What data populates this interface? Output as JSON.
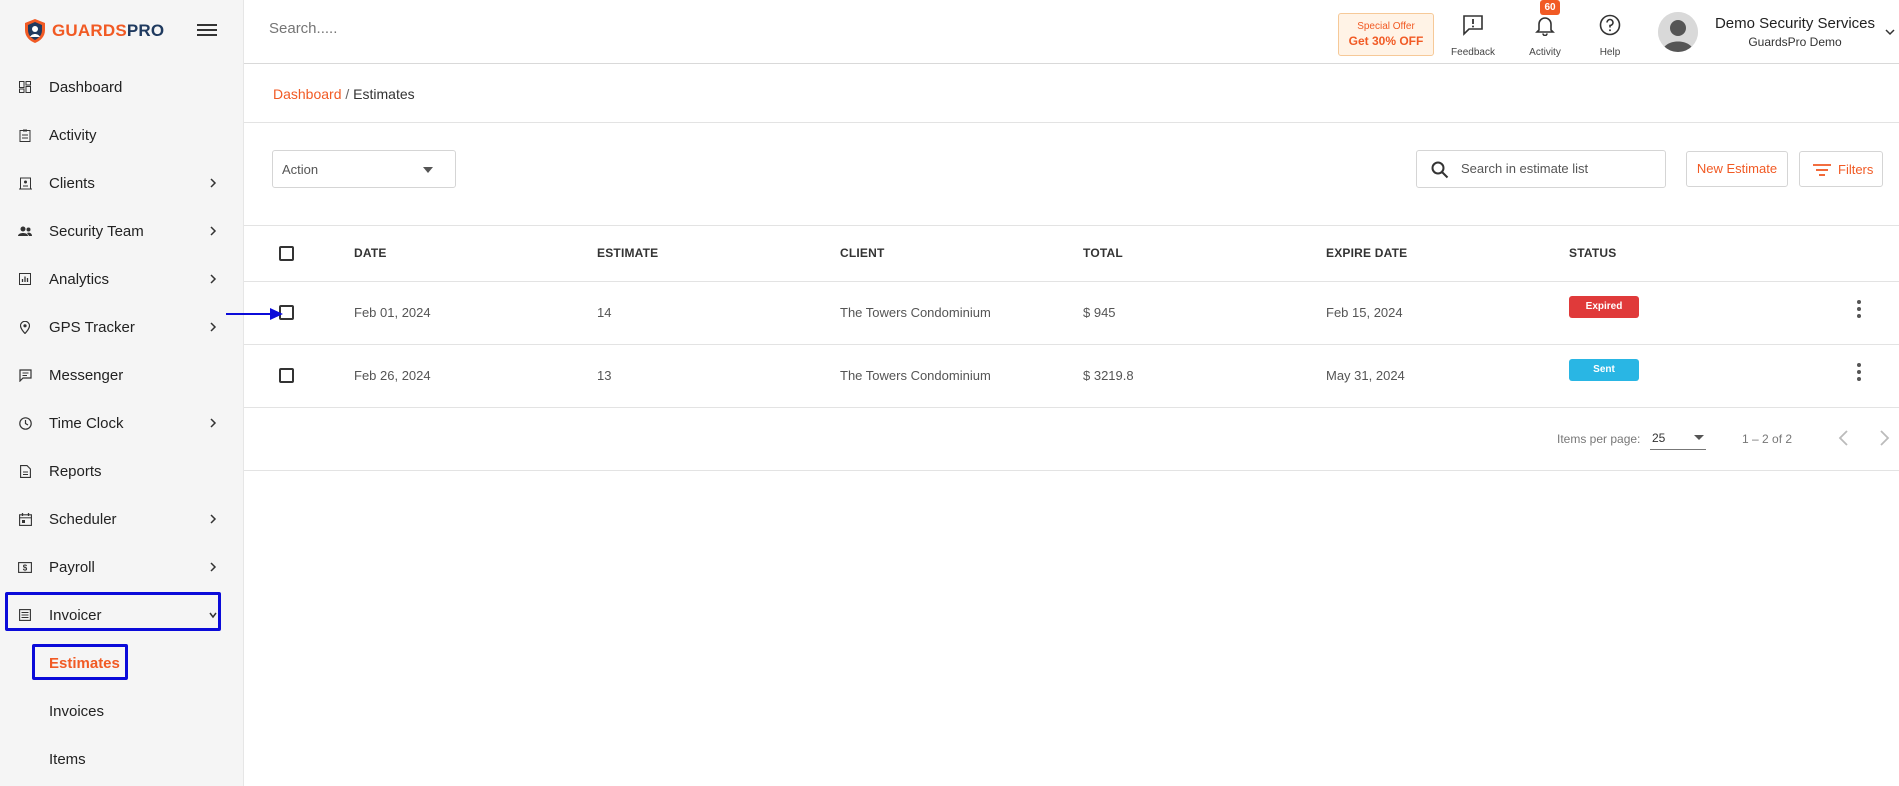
{
  "brand": {
    "part1": "GUARDS",
    "part2": "PRO"
  },
  "colors": {
    "accent": "#f15a24",
    "expired": "#e03a3a",
    "sent": "#29b6e4",
    "highlight": "#0b0bd9"
  },
  "sidebar": {
    "items": [
      {
        "label": "Dashboard",
        "icon": "dashboard-icon",
        "chevron": false
      },
      {
        "label": "Activity",
        "icon": "clipboard-icon",
        "chevron": false
      },
      {
        "label": "Clients",
        "icon": "building-icon",
        "chevron": true
      },
      {
        "label": "Security Team",
        "icon": "team-icon",
        "chevron": true
      },
      {
        "label": "Analytics",
        "icon": "chart-icon",
        "chevron": true
      },
      {
        "label": "GPS Tracker",
        "icon": "location-pin-icon",
        "chevron": true
      },
      {
        "label": "Messenger",
        "icon": "message-icon",
        "chevron": false
      },
      {
        "label": "Time Clock",
        "icon": "clock-icon",
        "chevron": true
      },
      {
        "label": "Reports",
        "icon": "report-icon",
        "chevron": false
      },
      {
        "label": "Scheduler",
        "icon": "calendar-icon",
        "chevron": true
      },
      {
        "label": "Payroll",
        "icon": "payroll-icon",
        "chevron": true
      },
      {
        "label": "Invoicer",
        "icon": "invoice-icon",
        "chevron": "down"
      }
    ],
    "subitems": [
      "Estimates",
      "Invoices",
      "Items"
    ],
    "active_subitem": "Estimates"
  },
  "topbar": {
    "search_placeholder": "Search.....",
    "offer_line1": "Special Offer",
    "offer_line2": "Get 30% OFF",
    "feedback_label": "Feedback",
    "activity_label": "Activity",
    "activity_badge": "60",
    "help_label": "Help",
    "user_name": "Demo Security Services",
    "user_sub": "GuardsPro Demo"
  },
  "breadcrumb": {
    "link": "Dashboard",
    "sep": " / ",
    "current": "Estimates"
  },
  "toolbar": {
    "action_label": "Action",
    "search_placeholder": "Search in estimate list",
    "new_label": "New Estimate",
    "filters_label": "Filters"
  },
  "table": {
    "headers": [
      "DATE",
      "ESTIMATE",
      "CLIENT",
      "TOTAL",
      "EXPIRE DATE",
      "STATUS"
    ],
    "rows": [
      {
        "date": "Feb 01, 2024",
        "estimate": "14",
        "client": "The Towers Condominium",
        "total": "$ 945",
        "expire": "Feb 15, 2024",
        "status": "Expired",
        "status_color": "#e03a3a"
      },
      {
        "date": "Feb 26, 2024",
        "estimate": "13",
        "client": "The Towers Condominium",
        "total": "$ 3219.8",
        "expire": "May 31, 2024",
        "status": "Sent",
        "status_color": "#29b6e4"
      }
    ]
  },
  "pagination": {
    "per_page_label": "Items per page:",
    "per_page": "25",
    "range": "1 – 2 of 2"
  }
}
